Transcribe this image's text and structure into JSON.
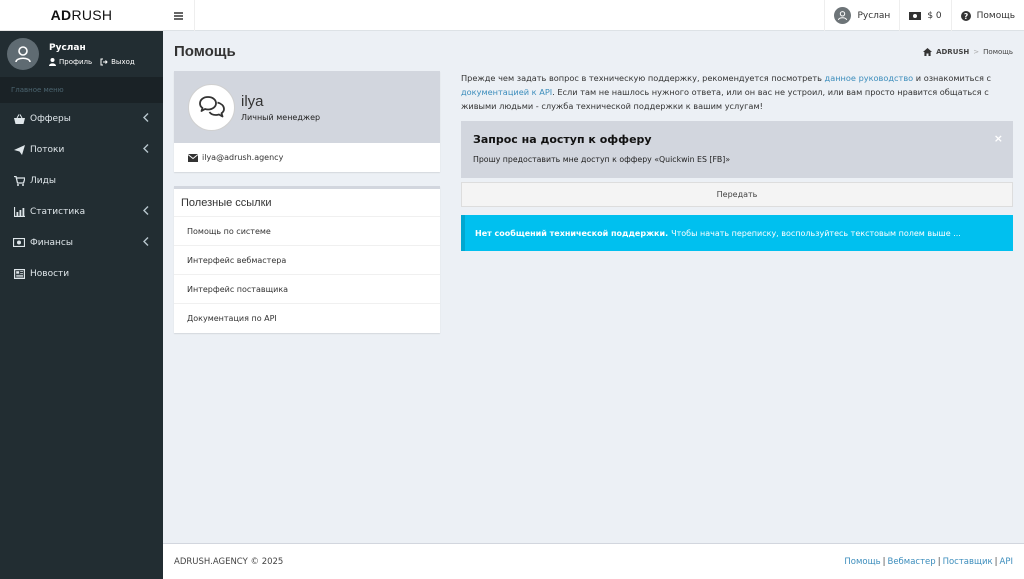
{
  "brand": {
    "logo_bold": "AD",
    "logo_rest": "RUSH"
  },
  "user": {
    "name": "Руслан",
    "profile_label": "Профиль",
    "logout_label": "Выход"
  },
  "sidebar": {
    "header": "Главное меню",
    "items": [
      {
        "label": "Офферы",
        "icon": "basket-icon",
        "has_children": true
      },
      {
        "label": "Потоки",
        "icon": "paper-plane-icon",
        "has_children": true
      },
      {
        "label": "Лиды",
        "icon": "cart-icon",
        "has_children": false
      },
      {
        "label": "Статистика",
        "icon": "chart-icon",
        "has_children": true
      },
      {
        "label": "Финансы",
        "icon": "money-icon",
        "has_children": true
      },
      {
        "label": "Новости",
        "icon": "newspaper-icon",
        "has_children": false
      }
    ]
  },
  "topbar": {
    "user_name": "Руслан",
    "balance": "$ 0",
    "help_label": "Помощь"
  },
  "page": {
    "title": "Помощь"
  },
  "breadcrumb": {
    "root": "ADRUSH",
    "current": "Помощь"
  },
  "manager": {
    "name": "ilya",
    "role": "Личный менеджер",
    "email": "ilya@adrush.agency"
  },
  "useful_links": {
    "title": "Полезные ссылки",
    "items": [
      "Помощь по системе",
      "Интерфейс вебмастера",
      "Интерфейс поставщика",
      "Документация по API"
    ]
  },
  "intro": {
    "part1": "Прежде чем задать вопрос в техническую поддержку, рекомендуется посмотреть ",
    "link1": "данное руководство",
    "part2": " и ознакомиться с ",
    "link2": "документацией к API",
    "part3": ". Если там не нашлось нужного ответа, или он вас не устроил, или вам просто нравится общаться с живыми людьми - служба технической поддержки к вашим услугам!"
  },
  "request": {
    "title": "Запрос на доступ к офферу",
    "text": "Прошу предоставить мне доступ к офферу «Quickwin ES [FB]»",
    "close": "×",
    "submit_label": "Передать"
  },
  "callout": {
    "bold": "Нет сообщений технической поддержки.",
    "text": "Чтобы начать переписку, воспользуйтесь текстовым полем выше ..."
  },
  "footer": {
    "copyright": "ADRUSH.AGENCY © 2025",
    "links": [
      "Помощь",
      "Вебмастер",
      "Поставщик",
      "API"
    ],
    "separator": "|"
  },
  "colors": {
    "sidebar_bg": "#222d32",
    "accent_link": "#3c8dbc",
    "callout_bg": "#00c0ef",
    "box_head_bg": "#d2d6de"
  }
}
